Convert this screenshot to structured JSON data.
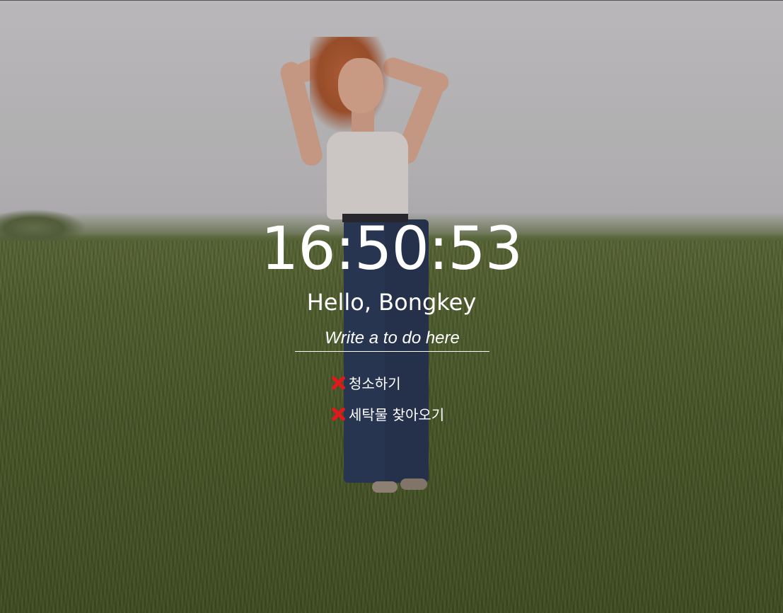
{
  "clock": {
    "time": "16:50:53"
  },
  "greeting": {
    "text": "Hello, Bongkey"
  },
  "todo_form": {
    "placeholder": "Write a to do here"
  },
  "todos": [
    {
      "text": "청소하기",
      "delete_icon": "red-x-icon"
    },
    {
      "text": "세탁물 찾아오기",
      "delete_icon": "red-x-icon"
    }
  ],
  "colors": {
    "text": "#ffffff",
    "delete_icon": "#e0191c"
  }
}
